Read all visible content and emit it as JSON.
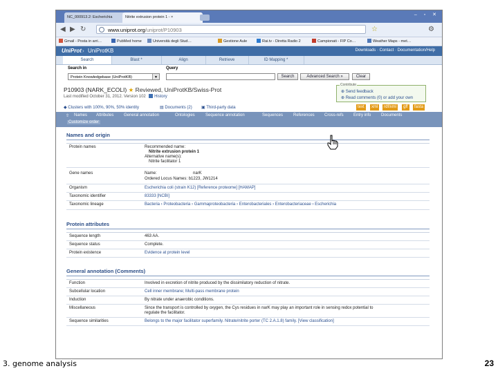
{
  "browser": {
    "tabs": [
      {
        "label": "NC_000913.2: Escherichia"
      },
      {
        "label": "Nitrite extrusion protein 1 - ×"
      }
    ],
    "url": {
      "host": "www.uniprot.org",
      "path": "/uniprot/P10903"
    },
    "bookmarks": [
      "Gmail - Posta in arri…",
      "PubMed home",
      "Università degli Stud…",
      "Gestione Aule",
      "Rai.tv - Diretta Radio 2",
      "Campionati - FIP Co…",
      "Weather Maps - met…"
    ]
  },
  "uniprot": {
    "logo": "UniProt",
    "product": "UniProtKB",
    "top_links": "Downloads · Contact · Documentation/Help",
    "nav_tabs": [
      "Search",
      "Blast *",
      "Align",
      "Retrieve",
      "ID Mapping *"
    ],
    "search_in_label": "Search in",
    "query_label": "Query",
    "search_in_value": "Protein Knowledgebase (UniProtKB)",
    "search_button": "Search",
    "advanced_button": "Advanced Search »",
    "clear_button": "Clear"
  },
  "entry": {
    "accession": "P10903 (NARK_ECOLI)",
    "reviewed": "Reviewed, UniProtKB/Swiss-Prot",
    "modified": "Last modified October 31, 2012. Version 102",
    "history": "History",
    "contribute_title": "Contribute",
    "contribute_links": [
      "Send feedback",
      "Read comments (0) or add your own"
    ],
    "tools": [
      "Clusters with 100%, 90%, 50% identity",
      "Documents (2)",
      "Third-party data"
    ],
    "formats": [
      "text",
      "xml",
      "rdf/xml",
      "gff",
      "fasta"
    ],
    "section_nav": [
      "Names",
      "Attributes",
      "General annotation",
      "Ontologies",
      "Sequence annotation",
      "Sequences",
      "References",
      "Cross-refs",
      "Entry info",
      "Documents"
    ],
    "customize": "Customize order"
  },
  "names_and_origin": {
    "title": "Names and origin",
    "protein_names_label": "Protein names",
    "recommended_label": "Recommended name:",
    "recommended_value": "Nitrite extrusion protein 1",
    "alternative_label": "Alternative name(s):",
    "alternative_value": "Nitrite facilitator 1",
    "gene_names_label": "Gene names",
    "gene_name_label": "Name:",
    "gene_name_value": "narK",
    "ordered_locus": "Ordered Locus Names: b1223, JW1214",
    "organism_label": "Organism",
    "organism_value": "Escherichia coli (strain K12) [Reference proteome] [HAMAP]",
    "taxonomic_id_label": "Taxonomic identifier",
    "taxonomic_id_value": "83333 [NCBI]",
    "lineage_label": "Taxonomic lineage",
    "lineage_value": "Bacteria › Proteobacteria › Gammaproteobacteria › Enterobacteriales › Enterobacteriaceae › Escherichia"
  },
  "protein_attributes": {
    "title": "Protein attributes",
    "rows": [
      {
        "label": "Sequence length",
        "value": "463 AA."
      },
      {
        "label": "Sequence status",
        "value": "Complete."
      },
      {
        "label": "Protein existence",
        "value": "Evidence at protein level"
      }
    ]
  },
  "general_annotation": {
    "title": "General annotation (Comments)",
    "rows": [
      {
        "label": "Function",
        "value": "Involved in excretion of nitrite produced by the dissimilatory reduction of nitrate."
      },
      {
        "label": "Subcellular location",
        "value": "Cell inner membrane; Multi-pass membrane protein"
      },
      {
        "label": "Induction",
        "value": "By nitrate under anaerobic conditions."
      },
      {
        "label": "Miscellaneous",
        "value": "Since the transport is controlled by oxygen, the Cys residues in narK may play an important role in sensing redox potential to",
        "value2": "regulate the facilitator."
      },
      {
        "label": "Sequence similarities",
        "value": "Belongs to the major facilitator superfamily. Nitrate/nitrite porter (TC 2.A.1.8) family. [View classification]"
      }
    ]
  },
  "slide": {
    "caption": "3. genome analysis",
    "page_number": "23"
  }
}
